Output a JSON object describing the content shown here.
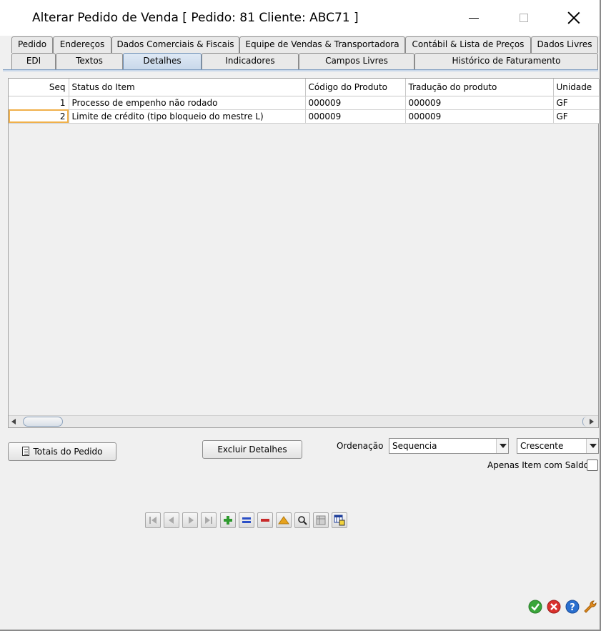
{
  "window": {
    "title": "Alterar Pedido de Venda [ Pedido: 81 Cliente: ABC71 ]"
  },
  "tabs": {
    "row1": [
      {
        "label": "Pedido"
      },
      {
        "label": "Endereços"
      },
      {
        "label": "Dados Comerciais & Fiscais"
      },
      {
        "label": "Equipe de Vendas & Transportadora"
      },
      {
        "label": "Contábil & Lista de Preços"
      },
      {
        "label": "Dados Livres"
      }
    ],
    "row2": [
      {
        "label": "EDI"
      },
      {
        "label": "Textos"
      },
      {
        "label": "Detalhes"
      },
      {
        "label": "Indicadores"
      },
      {
        "label": "Campos Livres"
      },
      {
        "label": "Histórico de Faturamento"
      }
    ],
    "active": "Detalhes"
  },
  "grid": {
    "columns": [
      "Seq",
      "Status do Item",
      "Código do Produto",
      "Tradução do produto",
      "Unidade"
    ],
    "rows": [
      {
        "seq": "1",
        "status": "Processo de empenho não rodado",
        "codigo": "000009",
        "traducao": "000009",
        "unidade": "GF"
      },
      {
        "seq": "2",
        "status": "Limite de crédito (tipo bloqueio do mestre L)",
        "codigo": "000009",
        "traducao": "000009",
        "unidade": "GF"
      }
    ]
  },
  "actions": {
    "totais_label": "Totais do Pedido",
    "excluir_label": "Excluir Detalhes",
    "ordenacao_label": "Ordenação",
    "ordenacao_value": "Sequencia",
    "direcao_value": "Crescente",
    "apenas_saldo_label": "Apenas Item com Saldo"
  },
  "colors": {
    "ok": "#3aa63a",
    "cancel": "#d9302c",
    "help": "#2a6fcf",
    "tools": "#e08a1e",
    "add": "#2e9a2e",
    "equal": "#2b4fc7",
    "remove": "#c82a2a",
    "up": "#e7a21c"
  }
}
